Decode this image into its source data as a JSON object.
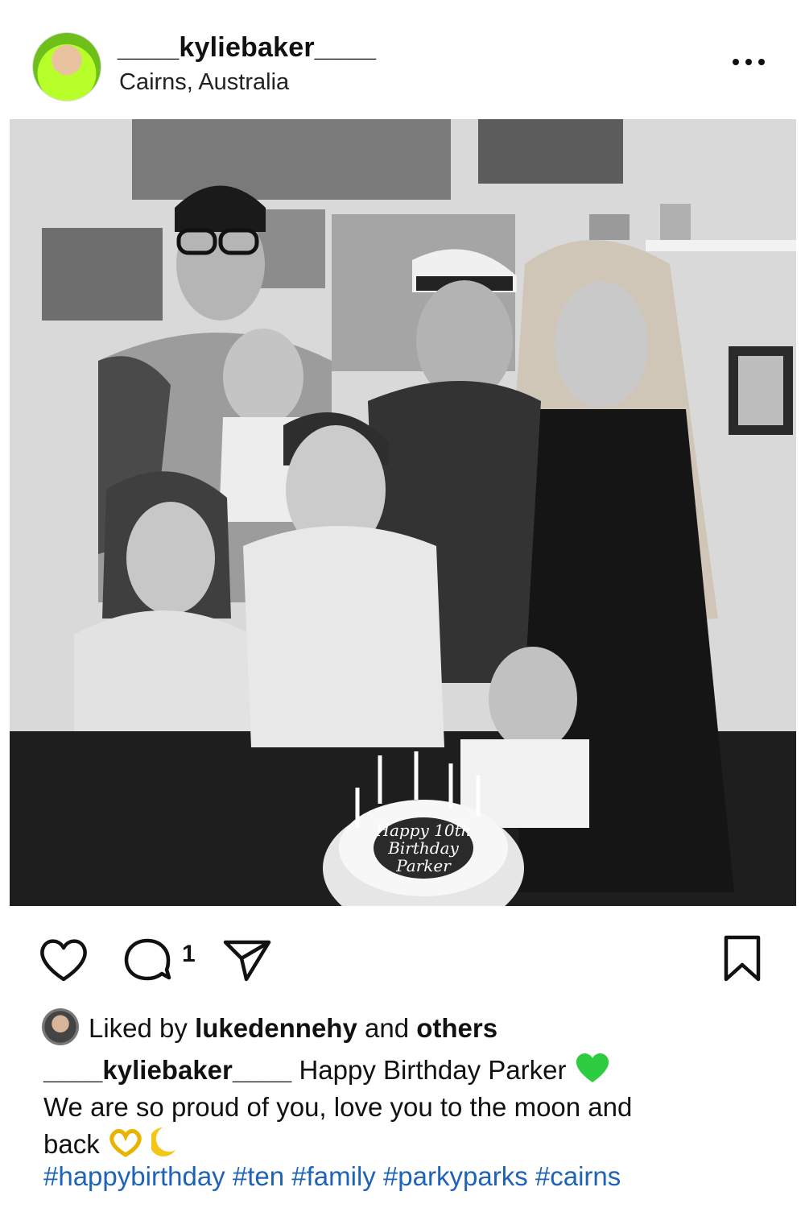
{
  "post": {
    "username": "____kyliebaker____",
    "location": "Cairns, Australia"
  },
  "photo": {
    "cake_text": [
      "Happy 10th",
      "Birthday",
      "Parker"
    ]
  },
  "actions": {
    "comment_count": "1"
  },
  "likes": {
    "prefix": "Liked by ",
    "user": "lukedennehy",
    "middle": " and ",
    "others": "others"
  },
  "caption": {
    "username": "____kyliebaker____",
    "line1": "Happy Birthday Parker",
    "line2": "We are so proud of you, love you to the moon and",
    "line3": "back"
  },
  "hashtags": [
    "#happybirthday",
    "#ten",
    "#family",
    "#parkyparks",
    "#cairns"
  ],
  "colors": {
    "hashtag": "#1e63b6",
    "heart_emoji": "#2ecc40"
  },
  "icons": {
    "more": "more-dots-icon",
    "like": "heart-outline-icon",
    "comment": "comment-bubble-icon",
    "share": "paper-plane-icon",
    "save": "bookmark-outline-icon"
  }
}
